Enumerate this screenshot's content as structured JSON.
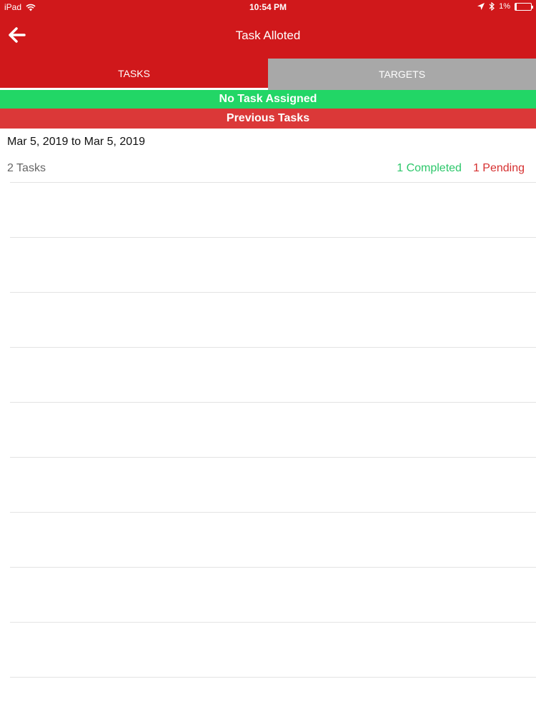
{
  "status_bar": {
    "device": "iPad",
    "time": "10:54 PM",
    "battery": "1%"
  },
  "nav": {
    "title": "Task Alloted"
  },
  "tabs": [
    {
      "label": "TASKS"
    },
    {
      "label": "TARGETS"
    }
  ],
  "banners": {
    "no_task": "No Task Assigned",
    "previous": "Previous Tasks"
  },
  "period": {
    "range": "Mar 5, 2019 to Mar 5, 2019",
    "tasks_count": "2 Tasks",
    "completed": "1 Completed",
    "pending": "1 Pending"
  },
  "colors": {
    "header": "#d0181b",
    "tab_inactive": "#a8a8a8",
    "no_task": "#22d666",
    "previous": "#db3838",
    "completed": "#2cc76a",
    "pending": "#d63030"
  },
  "icons": {
    "back": "arrow-left-icon",
    "wifi": "wifi-icon",
    "location": "location-arrow-icon",
    "bluetooth": "bluetooth-icon",
    "battery": "battery-icon"
  }
}
